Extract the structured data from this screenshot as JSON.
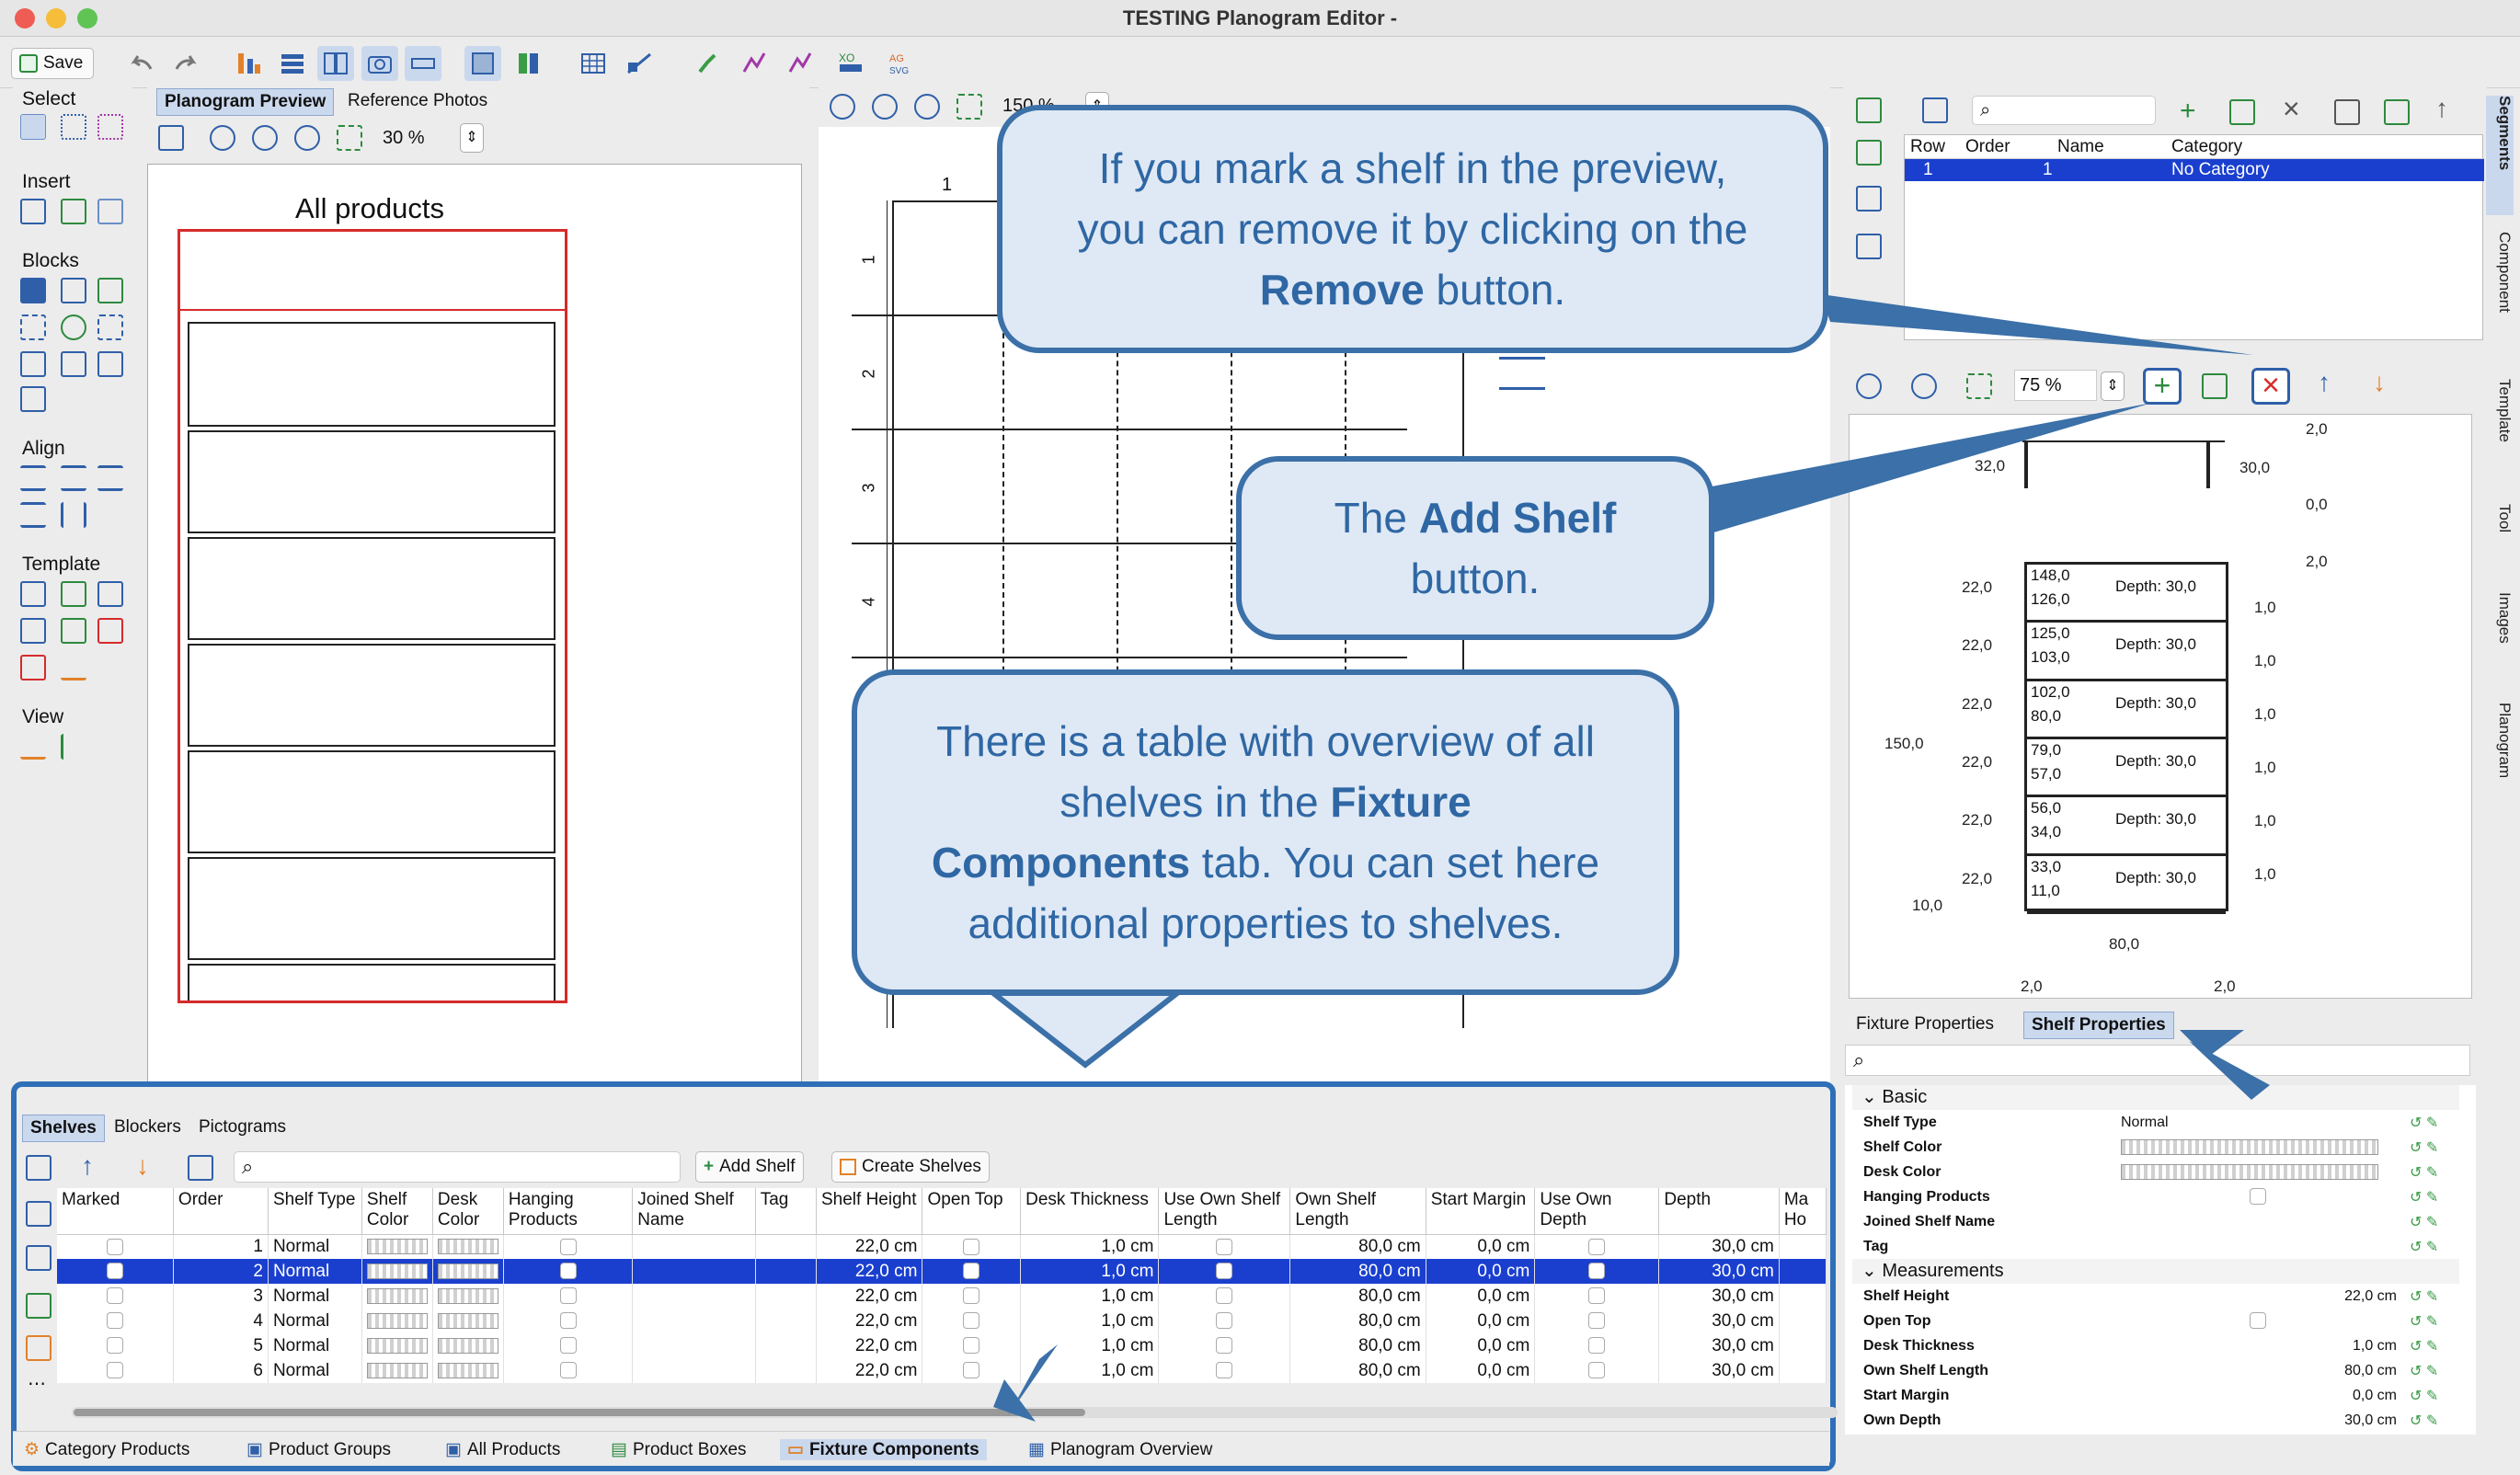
{
  "window": {
    "title": "TESTING Planogram Editor -"
  },
  "toolbar": {
    "save_label": "Save"
  },
  "left_panel": {
    "sections": [
      "Select",
      "Insert",
      "Blocks",
      "Align",
      "Template",
      "View"
    ]
  },
  "preview": {
    "tabs": [
      "Planogram Preview",
      "Reference Photos"
    ],
    "zoom": "30 %",
    "heading": "All products"
  },
  "center": {
    "zoom": "150 %",
    "column_label": "1",
    "row_labels": [
      "1",
      "2",
      "3",
      "4"
    ]
  },
  "segments": {
    "columns": [
      "Row",
      "Order",
      "Name",
      "Category"
    ],
    "row": {
      "row": "1",
      "order": "1",
      "name": "",
      "category": "No Category"
    }
  },
  "fixture_view": {
    "zoom": "75 %",
    "dims": {
      "top_right": "2,0",
      "left_top": "32,0",
      "right_top": "30,0",
      "zero": "0,0",
      "right_2": "2,0",
      "left_total": "150,0",
      "bottom_left": "10,0",
      "width": "80,0",
      "bottom_a": "2,0",
      "bottom_b": "2,0",
      "shelf_heights": [
        "22,0",
        "22,0",
        "22,0",
        "22,0",
        "22,0",
        "22,0"
      ],
      "right_ones": [
        "1,0",
        "1,0",
        "1,0",
        "1,0",
        "1,0",
        "1,0"
      ],
      "shelves": [
        {
          "top": "148,0",
          "bottom": "126,0",
          "depth": "Depth: 30,0"
        },
        {
          "top": "125,0",
          "bottom": "103,0",
          "depth": "Depth: 30,0"
        },
        {
          "top": "102,0",
          "bottom": "80,0",
          "depth": "Depth: 30,0"
        },
        {
          "top": "79,0",
          "bottom": "57,0",
          "depth": "Depth: 30,0"
        },
        {
          "top": "56,0",
          "bottom": "34,0",
          "depth": "Depth: 30,0"
        },
        {
          "top": "33,0",
          "bottom": "11,0",
          "depth": "Depth: 30,0"
        }
      ]
    },
    "tabs": [
      "Fixture Properties",
      "Shelf Properties"
    ]
  },
  "properties": {
    "groups": [
      {
        "title": "Basic",
        "rows": [
          {
            "name": "Shelf Type",
            "value": "Normal"
          },
          {
            "name": "Shelf Color",
            "value": ""
          },
          {
            "name": "Desk Color",
            "value": ""
          },
          {
            "name": "Hanging Products",
            "value": ""
          },
          {
            "name": "Joined Shelf Name",
            "value": ""
          },
          {
            "name": "Tag",
            "value": ""
          }
        ]
      },
      {
        "title": "Measurements",
        "rows": [
          {
            "name": "Shelf Height",
            "value": "22,0 cm"
          },
          {
            "name": "Open Top",
            "value": ""
          },
          {
            "name": "Desk Thickness",
            "value": "1,0 cm"
          },
          {
            "name": "Own Shelf Length",
            "value": "80,0 cm"
          },
          {
            "name": "Start Margin",
            "value": "0,0 cm"
          },
          {
            "name": "Own Depth",
            "value": "30,0 cm"
          }
        ]
      }
    ]
  },
  "right_vertical_tabs": [
    "Segments",
    "Component",
    "Template",
    "Tool",
    "Images",
    "Planogram"
  ],
  "bottom_panel": {
    "tabs": [
      "Shelves",
      "Blockers",
      "Pictograms"
    ],
    "add_shelf": "Add Shelf",
    "create_shelves": "Create Shelves",
    "columns": [
      "Marked",
      "Order",
      "Shelf Type",
      "Shelf Color",
      "Desk Color",
      "Hanging Products",
      "Joined Shelf Name",
      "Tag",
      "Shelf Height",
      "Open Top",
      "Desk Thickness",
      "Use Own Shelf Length",
      "Own Shelf Length",
      "Start Margin",
      "Use Own Depth",
      "Depth",
      "Ma Ho"
    ],
    "rows": [
      {
        "order": "1",
        "type": "Normal",
        "height": "22,0 cm",
        "thickness": "1,0 cm",
        "length": "80,0 cm",
        "margin": "0,0 cm",
        "depth": "30,0 cm"
      },
      {
        "order": "2",
        "type": "Normal",
        "height": "22,0 cm",
        "thickness": "1,0 cm",
        "length": "80,0 cm",
        "margin": "0,0 cm",
        "depth": "30,0 cm"
      },
      {
        "order": "3",
        "type": "Normal",
        "height": "22,0 cm",
        "thickness": "1,0 cm",
        "length": "80,0 cm",
        "margin": "0,0 cm",
        "depth": "30,0 cm"
      },
      {
        "order": "4",
        "type": "Normal",
        "height": "22,0 cm",
        "thickness": "1,0 cm",
        "length": "80,0 cm",
        "margin": "0,0 cm",
        "depth": "30,0 cm"
      },
      {
        "order": "5",
        "type": "Normal",
        "height": "22,0 cm",
        "thickness": "1,0 cm",
        "length": "80,0 cm",
        "margin": "0,0 cm",
        "depth": "30,0 cm"
      },
      {
        "order": "6",
        "type": "Normal",
        "height": "22,0 cm",
        "thickness": "1,0 cm",
        "length": "80,0 cm",
        "margin": "0,0 cm",
        "depth": "30,0 cm"
      }
    ],
    "selected_row": 1
  },
  "bottom_tabs": [
    "Category Products",
    "Product Groups",
    "All Products",
    "Product Boxes",
    "Fixture Components",
    "Planogram Overview"
  ],
  "callouts": {
    "remove": {
      "l1": "If you mark a shelf in the preview,",
      "l2": "you can remove it by clicking on the",
      "bold": "Remove",
      "l3": " button."
    },
    "add": {
      "l1": "The ",
      "bold": "Add Shelf",
      "l2": "button."
    },
    "table": {
      "l1": "There is a table with overview of all",
      "l2a": "shelves in the ",
      "bold1": "Fixture",
      "bold2": "Components",
      "l3": " tab. You can set here",
      "l4": "additional properties to shelves."
    }
  },
  "colors": {
    "accent_blue": "#3b70a8",
    "callout_fill": "#dfe9f5",
    "selection": "#1a3fcf",
    "remove_red": "#d62b2b"
  }
}
